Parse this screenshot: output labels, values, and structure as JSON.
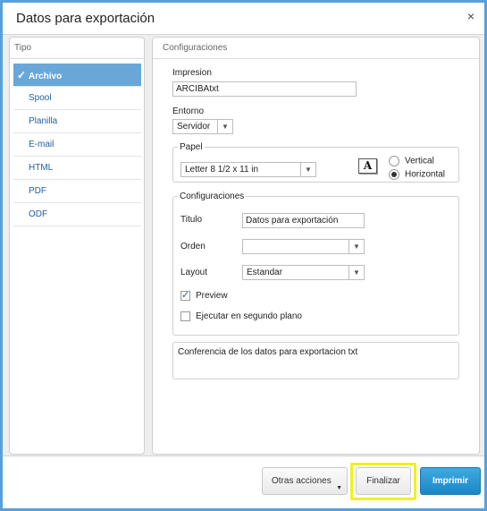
{
  "window": {
    "title": "Datos para exportación",
    "close_symbol": "×"
  },
  "left_panel": {
    "header": "Tipo",
    "check_symbol": "✓",
    "items": [
      {
        "label": "Archivo",
        "active": true
      },
      {
        "label": "Spool"
      },
      {
        "label": "Planilla"
      },
      {
        "label": "E-mail"
      },
      {
        "label": "HTML"
      },
      {
        "label": "PDF"
      },
      {
        "label": "ODF"
      }
    ]
  },
  "right_panel": {
    "header": "Configuraciones",
    "impresion": {
      "label": "Impresion",
      "value": "ARCIBAtxt"
    },
    "entorno": {
      "label": "Entorno",
      "value": "Servidor"
    },
    "papel": {
      "legend": "Papel",
      "size_value": "Letter 8 1/2 x 11 in",
      "font_icon": "A",
      "orientation_options": [
        {
          "label": "Vertical",
          "selected": false
        },
        {
          "label": "Horizontal",
          "selected": true
        }
      ]
    },
    "config_group": {
      "legend": "Configuraciones",
      "titulo": {
        "label": "Titulo",
        "value": "Datos para exportación"
      },
      "orden": {
        "label": "Orden",
        "value": ""
      },
      "layout": {
        "label": "Layout",
        "value": "Estandar"
      },
      "preview": {
        "label": "Preview",
        "checked": true
      },
      "ejecutar": {
        "label": "Ejecutar en segundo plano",
        "checked": false
      }
    },
    "description": "Conferencia de los datos para exportacion txt"
  },
  "footer": {
    "more_actions": "Otras acciones",
    "finish": "Finalizar",
    "print": "Imprimir"
  },
  "glyphs": {
    "dropdown_arrow": "▼",
    "check": "✓"
  },
  "colors": {
    "accent": "#6aa7d9",
    "link": "#1f5f9a",
    "primary_button": "#1d87c6",
    "highlight": "#f1f11e",
    "window_border": "#5aa0d8"
  }
}
